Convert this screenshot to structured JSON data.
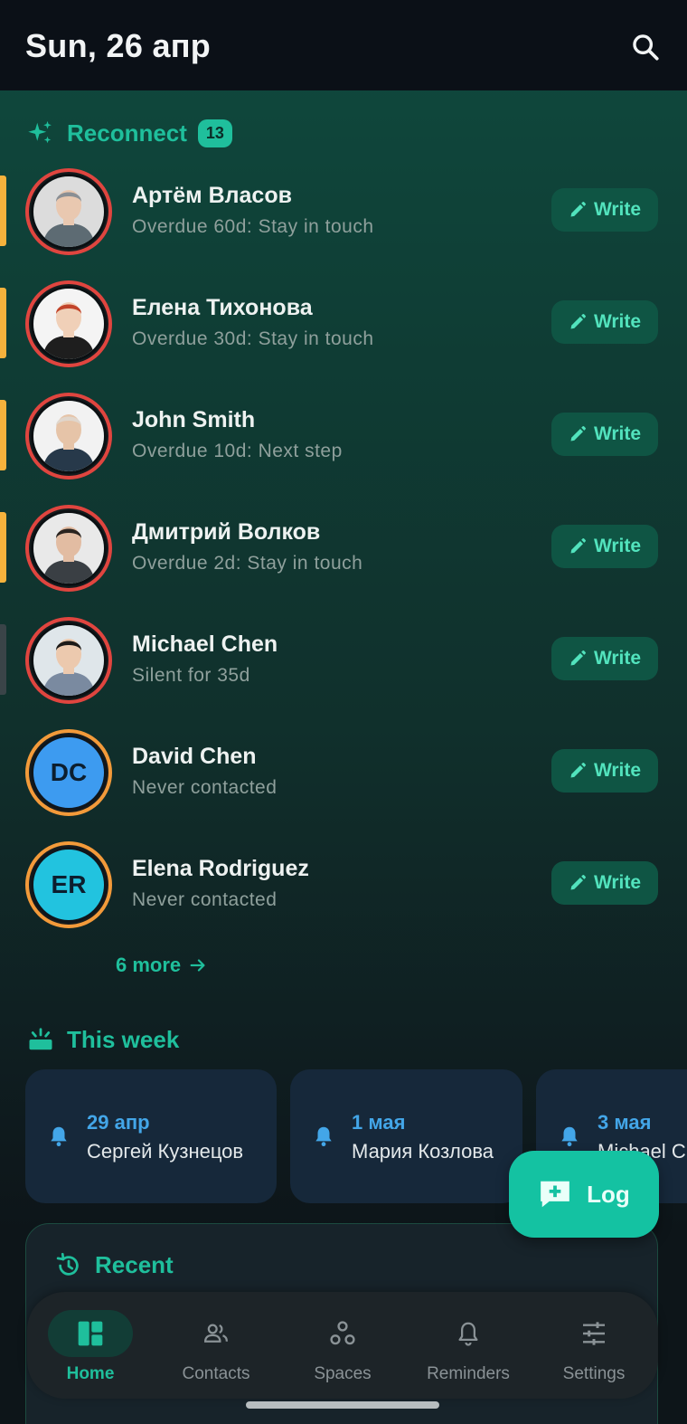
{
  "header": {
    "date": "Sun, 26 апр",
    "search_icon": "search-icon"
  },
  "reconnect": {
    "title": "Reconnect",
    "count": "13",
    "write_label": "Write",
    "more_label": "6 more",
    "contacts": [
      {
        "name": "Артём Власов",
        "status": "Overdue 60d: Stay in touch",
        "stripe": "overdue",
        "avatar": "photo",
        "ring": "#e0453f"
      },
      {
        "name": "Елена Тихонова",
        "status": "Overdue 30d: Stay in touch",
        "stripe": "overdue",
        "avatar": "photo",
        "ring": "#e0453f"
      },
      {
        "name": "John Smith",
        "status": "Overdue 10d: Next step",
        "stripe": "overdue",
        "avatar": "photo",
        "ring": "#e0453f"
      },
      {
        "name": "Дмитрий Волков",
        "status": "Overdue 2d: Stay in touch",
        "stripe": "overdue",
        "avatar": "photo",
        "ring": "#e0453f"
      },
      {
        "name": "Michael Chen",
        "status": "Silent for 35d",
        "stripe": "silent",
        "avatar": "photo",
        "ring": "#e0453f"
      },
      {
        "name": "David Chen",
        "status": "Never contacted",
        "stripe": "none",
        "avatar": "initials",
        "initials": "DC",
        "avatar_color": "#3d9bf0",
        "ring": "#f39a3a"
      },
      {
        "name": "Elena Rodriguez",
        "status": "Never contacted",
        "stripe": "none",
        "avatar": "initials",
        "initials": "ER",
        "avatar_color": "#22c3df",
        "ring": "#f39a3a"
      }
    ]
  },
  "this_week": {
    "title": "This week",
    "reminders": [
      {
        "date": "29 апр",
        "name": "Сергей Кузнецов"
      },
      {
        "date": "1 мая",
        "name": "Мария Козлова"
      },
      {
        "date": "3 мая",
        "name": "Michael C"
      }
    ]
  },
  "recent": {
    "title": "Recent"
  },
  "fab": {
    "label": "Log"
  },
  "nav": {
    "items": [
      {
        "label": "Home",
        "icon": "dashboard-icon",
        "active": true
      },
      {
        "label": "Contacts",
        "icon": "people-icon",
        "active": false
      },
      {
        "label": "Spaces",
        "icon": "spaces-icon",
        "active": false
      },
      {
        "label": "Reminders",
        "icon": "bell-icon",
        "active": false
      },
      {
        "label": "Settings",
        "icon": "sliders-icon",
        "active": false
      }
    ]
  },
  "colors": {
    "accent": "#1fbf9c",
    "overdue_stripe": "#f6b23c",
    "write_text": "#52e3bd",
    "reminder_date": "#43a6e8",
    "fab_bg": "#14c2a2"
  }
}
